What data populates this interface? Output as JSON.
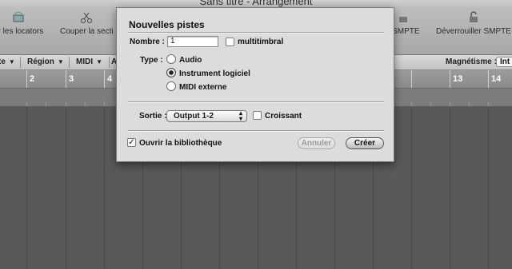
{
  "window": {
    "title": "Sans titre - Arrangement"
  },
  "toolbar": {
    "items": [
      {
        "label": "er les locators",
        "icon": "locators-icon"
      },
      {
        "label": "Couper la secti",
        "icon": "scissors-icon"
      },
      {
        "label": "r SMPTE",
        "icon": "lock-icon"
      },
      {
        "label": "Déverrouiller SMPTE",
        "icon": "unlock-icon"
      }
    ]
  },
  "menubar": {
    "items": [
      "te",
      "Région",
      "MIDI",
      "A"
    ],
    "snap_label": "Magnétisme :",
    "snap_value": "Int"
  },
  "ruler": {
    "bars": [
      "2",
      "3",
      "4",
      "13",
      "14"
    ]
  },
  "dialog": {
    "title": "Nouvelles pistes",
    "count_label": "Nombre :",
    "count_value": "1",
    "multitimbral_label": "multitimbral",
    "multitimbral_checked": false,
    "type_label": "Type :",
    "type_options": [
      {
        "label": "Audio",
        "selected": false
      },
      {
        "label": "Instrument logiciel",
        "selected": true
      },
      {
        "label": "MIDI externe",
        "selected": false
      }
    ],
    "output_label": "Sortie :",
    "output_value": "Output 1-2",
    "ascending_label": "Croissant",
    "ascending_checked": false,
    "library_label": "Ouvrir la bibliothèque",
    "library_checked": true,
    "cancel_label": "Annuler",
    "create_label": "Créer"
  }
}
